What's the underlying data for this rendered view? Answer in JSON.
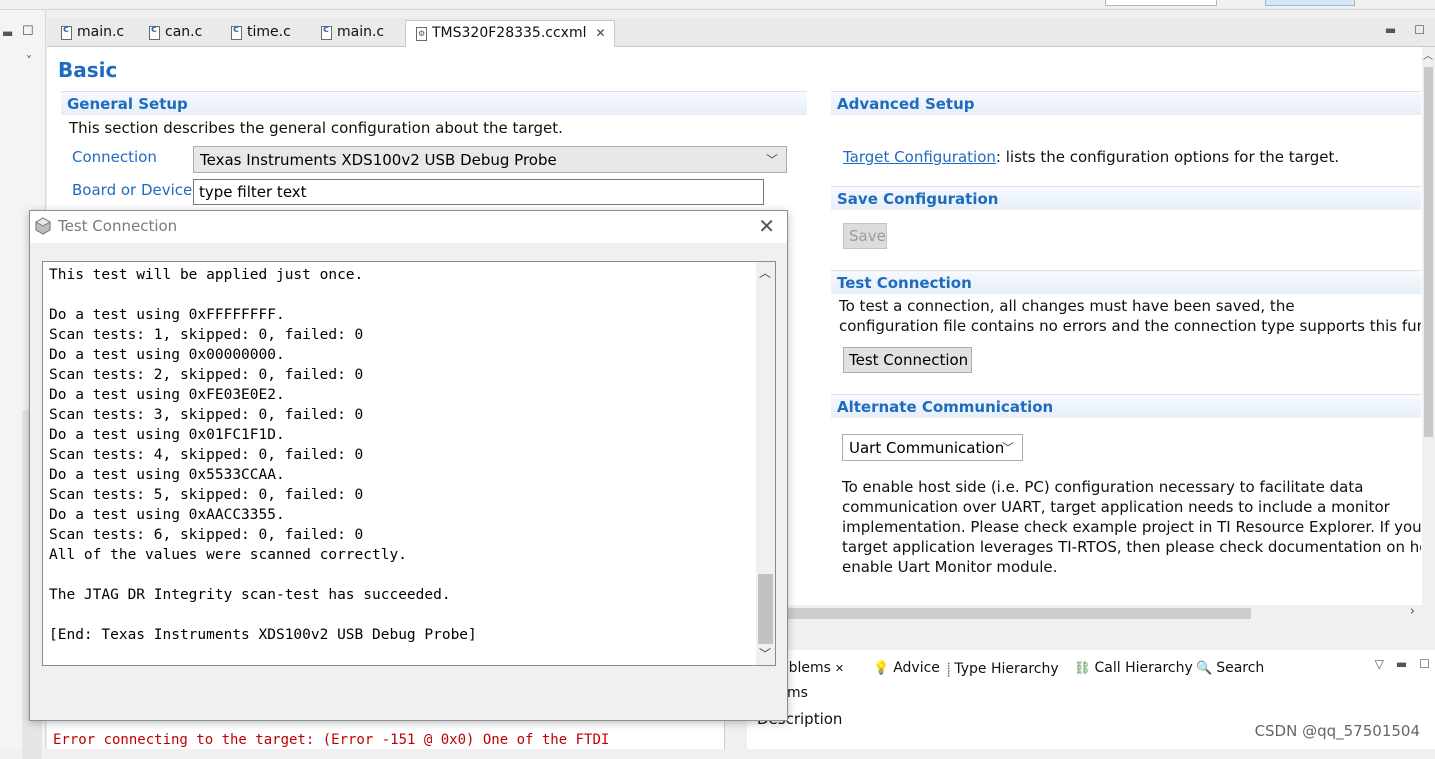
{
  "editor_tabs": [
    {
      "label": "main.c",
      "icon": "c-file-icon"
    },
    {
      "label": "can.c",
      "icon": "c-file-icon"
    },
    {
      "label": "time.c",
      "icon": "c-file-icon"
    },
    {
      "label": "main.c",
      "icon": "c-file-icon"
    },
    {
      "label": "TMS320F28335.ccxml",
      "icon": "ccxml-file-icon",
      "active": true
    }
  ],
  "page": {
    "title": "Basic"
  },
  "general_setup": {
    "header": "General Setup",
    "description": "This section describes the general configuration about the target.",
    "connection_label": "Connection",
    "connection_value": "Texas Instruments XDS100v2 USB Debug Probe",
    "board_label": "Board or Device",
    "board_filter_placeholder": "type filter text"
  },
  "advanced_setup": {
    "header": "Advanced Setup",
    "link_text": "Target Configuration",
    "link_suffix": ": lists the configuration options for the target."
  },
  "save_configuration": {
    "header": "Save Configuration",
    "save_button": "Save"
  },
  "test_connection": {
    "header": "Test Connection",
    "line1": "To test a connection, all changes must have been saved, the",
    "line2": "configuration file contains no errors and the connection type supports this funct",
    "button": "Test Connection"
  },
  "alternate_communication": {
    "header": "Alternate Communication",
    "select_value": "Uart Communication",
    "desc1": "To enable host side (i.e. PC) configuration necessary to facilitate data",
    "desc2": "communication over UART, target application needs to include a monitor",
    "desc3": "implementation. Please check example project in TI Resource Explorer. If your",
    "desc4": "target application leverages TI-RTOS, then please check documentation on how",
    "desc5": "enable Uart Monitor module."
  },
  "dialog": {
    "title": "Test Connection",
    "log": "This test will be applied just once.\n\nDo a test using 0xFFFFFFFF.\nScan tests: 1, skipped: 0, failed: 0\nDo a test using 0x00000000.\nScan tests: 2, skipped: 0, failed: 0\nDo a test using 0xFE03E0E2.\nScan tests: 3, skipped: 0, failed: 0\nDo a test using 0x01FC1F1D.\nScan tests: 4, skipped: 0, failed: 0\nDo a test using 0x5533CCAA.\nScan tests: 5, skipped: 0, failed: 0\nDo a test using 0xAACC3355.\nScan tests: 6, skipped: 0, failed: 0\nAll of the values were scanned correctly.\n\nThe JTAG DR Integrity scan-test has succeeded.\n\n[End: Texas Instruments XDS100v2 USB Debug Probe]"
  },
  "bottom_tabs": {
    "problems": "oblems",
    "advice": "Advice",
    "type_hierarchy": "Type Hierarchy",
    "call_hierarchy": "Call Hierarchy",
    "search": "Search"
  },
  "problems_view": {
    "items_label": "ms",
    "description_header": "Description"
  },
  "console": {
    "partial_error": "Error connecting to the target: (Error -151 @ 0x0) One of the FTDI"
  },
  "watermark": "CSDN @qq_57501504",
  "colors": {
    "section_header": "#1f6bbf",
    "link": "#1f6bbf",
    "console_error": "#c00000"
  }
}
